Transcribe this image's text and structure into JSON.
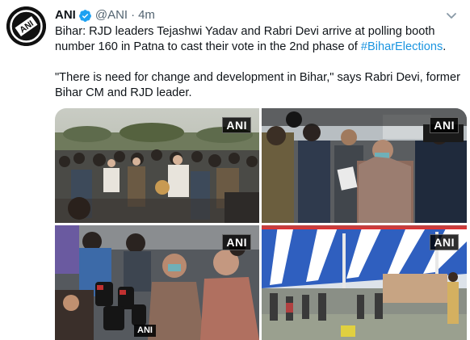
{
  "tweet": {
    "display_name": "ANI",
    "handle": "@ANI",
    "separator": "·",
    "time": "4m",
    "text_line1": "Bihar: RJD leaders Tejashwi Yadav and Rabri Devi arrive at polling booth number 160 in Patna to cast their vote in the 2nd phase of ",
    "hashtag": "#BiharElections",
    "text_line1_end": ".",
    "quote": "\"There is need for change and development in Bihar,\" says Rabri Devi, former Bihar CM and RJD leader."
  },
  "avatar": {
    "logo_text": "ANI"
  },
  "media": {
    "watermark": "ANI",
    "mic_label": "ANI",
    "photos": [
      {
        "subject": "crowd-outdoor"
      },
      {
        "subject": "leader-with-security"
      },
      {
        "subject": "microphones-media"
      },
      {
        "subject": "polling-tent"
      }
    ]
  },
  "colors": {
    "link": "#1b95e0",
    "verified": "#1da1f2",
    "secondary_text": "#536471"
  },
  "icons": {
    "verified": "verified-badge-icon",
    "more": "chevron-down-icon"
  }
}
